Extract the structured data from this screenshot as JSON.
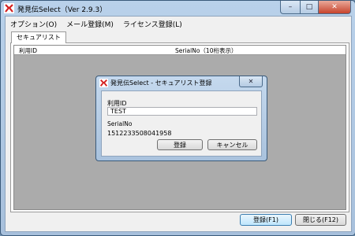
{
  "window": {
    "title": "発見伝Select（Ver 2.9.3）",
    "min_glyph": "–",
    "max_glyph": "□",
    "close_glyph": "✕"
  },
  "menu": {
    "items": [
      "オプション(O)",
      "メール登録(M)",
      "ライセンス登録(L)"
    ]
  },
  "tab": {
    "label": "セキュアリスト"
  },
  "table": {
    "columns": [
      "利用ID",
      "SerialNo（10桁表示）"
    ],
    "rows": []
  },
  "buttons": {
    "register": "登録(F1)",
    "close": "閉じる(F12)"
  },
  "dialog": {
    "title": "発見伝Select - セキュアリスト登録",
    "close_glyph": "✕",
    "user_id_label": "利用ID",
    "user_id_value": "TEST",
    "serial_label": "SerialNo",
    "serial_value": "1512233508041958",
    "register_label": "登録",
    "cancel_label": "キャンセル"
  },
  "colors": {
    "brand_red": "#d42020",
    "desktop": "#6f8fae"
  }
}
